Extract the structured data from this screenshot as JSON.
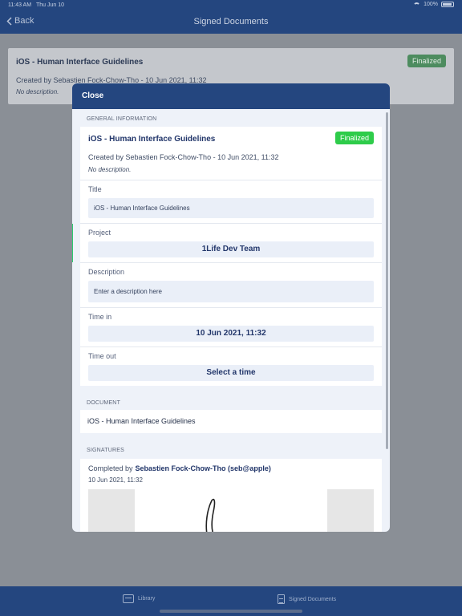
{
  "status_bar": {
    "time": "11:43 AM",
    "date": "Thu Jun 10",
    "battery": "100%"
  },
  "nav": {
    "back_label": "Back",
    "title": "Signed Documents"
  },
  "background_item": {
    "title": "iOS - Human Interface Guidelines",
    "created": "Created by Sebastien Fock-Chow-Tho - 10 Jun 2021, 11:32",
    "description": "No description.",
    "status": "Finalized"
  },
  "modal": {
    "close_label": "Close",
    "general_header": "GENERAL INFORMATION",
    "info": {
      "title": "iOS - Human Interface Guidelines",
      "status": "Finalized",
      "created": "Created by Sebastien Fock-Chow-Tho - 10 Jun 2021, 11:32",
      "description": "No description."
    },
    "fields": {
      "title_label": "Title",
      "title_value": "iOS - Human Interface Guidelines",
      "project_label": "Project",
      "project_value": "1Life Dev Team",
      "description_label": "Description",
      "description_placeholder": "Enter a description here",
      "time_in_label": "Time in",
      "time_in_value": "10 Jun 2021, 11:32",
      "time_out_label": "Time out",
      "time_out_value": "Select a time"
    },
    "document_header": "DOCUMENT",
    "document_name": "iOS - Human Interface Guidelines",
    "signatures_header": "SIGNATURES",
    "signature": {
      "completed_by_label": "Completed by",
      "signer": "Sebastien Fock-Chow-Tho (seb@apple)",
      "date": "10 Jun 2021, 11:32"
    }
  },
  "tabs": {
    "library": "Library",
    "signed": "Signed Documents"
  },
  "colors": {
    "primary": "#24467f",
    "success": "#2ecc4a",
    "accent_bar": "#2ecc71"
  }
}
